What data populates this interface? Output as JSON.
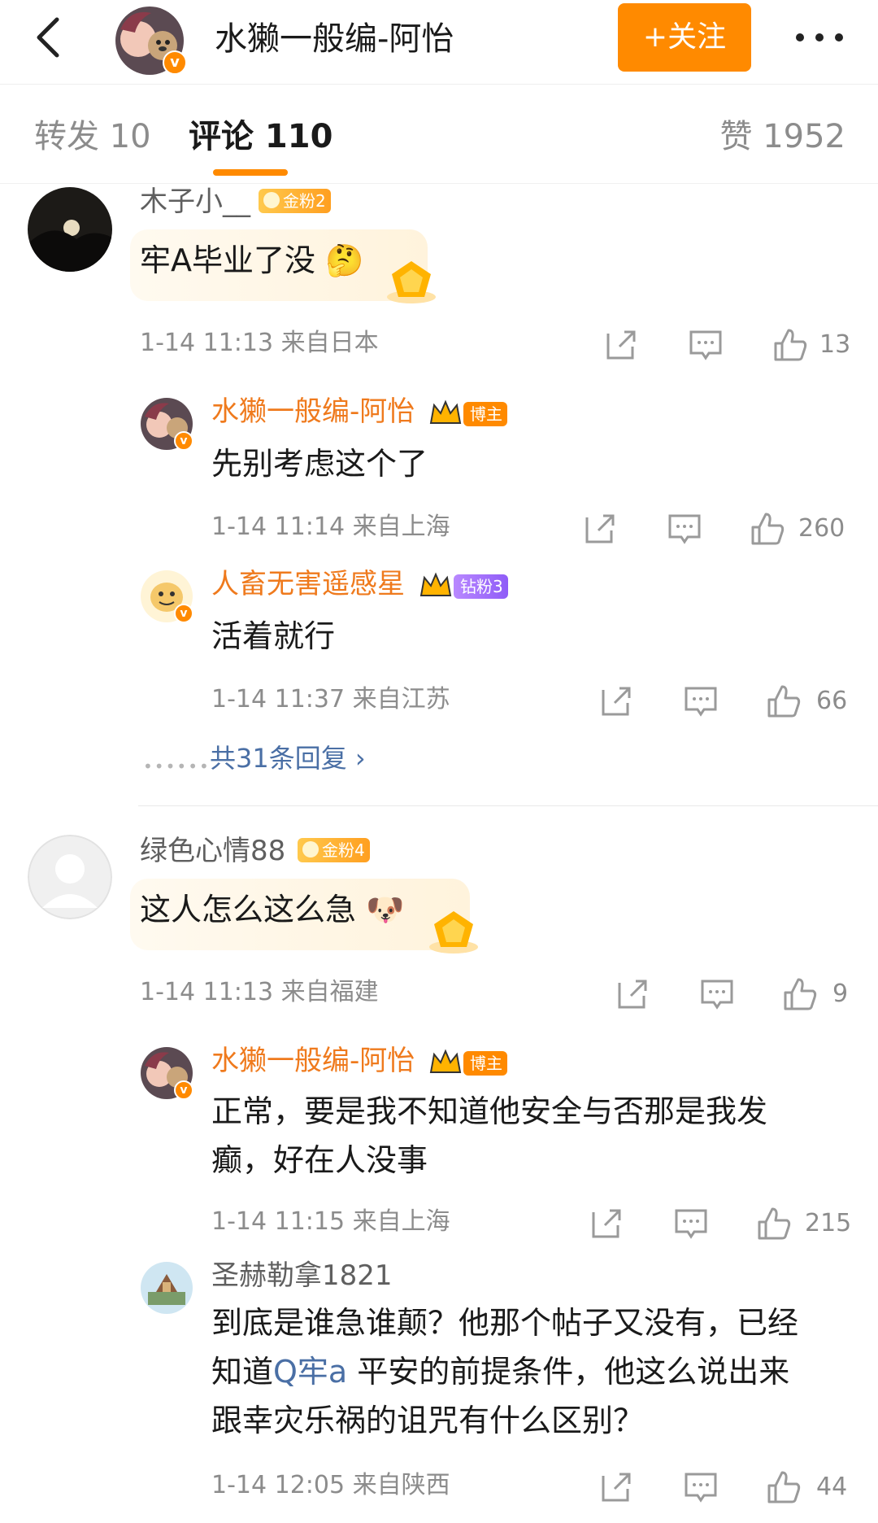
{
  "header": {
    "title": "水獭一般编-阿怡",
    "follow_label": "+关注"
  },
  "tabs": [
    {
      "label": "转发 10"
    },
    {
      "label": "评论 110"
    },
    {
      "label": "赞 1952"
    }
  ],
  "comments": [
    {
      "user": "木子小__",
      "badge": "金粉2",
      "text": "牢A毕业了没",
      "time": "1-14 11:13",
      "location": "来自日本",
      "likes": "13",
      "replies": [
        {
          "user": "水獭一般编-阿怡",
          "badge": "博主",
          "text": "先别考虑这个了",
          "time": "1-14 11:14",
          "location": "来自上海",
          "likes": "260"
        },
        {
          "user": "人畜无害遥感星",
          "badge": "钻粉3",
          "text": "活着就行",
          "time": "1-14 11:37",
          "location": "来自江苏",
          "likes": "66"
        }
      ],
      "more_replies": "共31条回复 ›"
    },
    {
      "user": "绿色心情88",
      "badge": "金粉4",
      "text": "这人怎么这么急",
      "time": "1-14 11:13",
      "location": "来自福建",
      "likes": "9",
      "replies": [
        {
          "user": "水獭一般编-阿怡",
          "badge": "博主",
          "text_line1": "正常，要是我不知道他安全与否那是我发",
          "text_line2": "癫，好在人没事",
          "time": "1-14 11:15",
          "location": "来自上海",
          "likes": "215"
        },
        {
          "user": "圣赫勒拿1821",
          "text_line1": "到底是谁急谁颠？他那个帖子又没有，已经",
          "text_line2_pre": "知道",
          "topic": "Q牢a",
          "text_line2_post": " 平安的前提条件，他这么说出来",
          "text_line3": "跟幸灾乐祸的诅咒有什么区别？",
          "time": "1-14 12:05",
          "location": "来自陕西",
          "likes": "44"
        }
      ]
    }
  ]
}
